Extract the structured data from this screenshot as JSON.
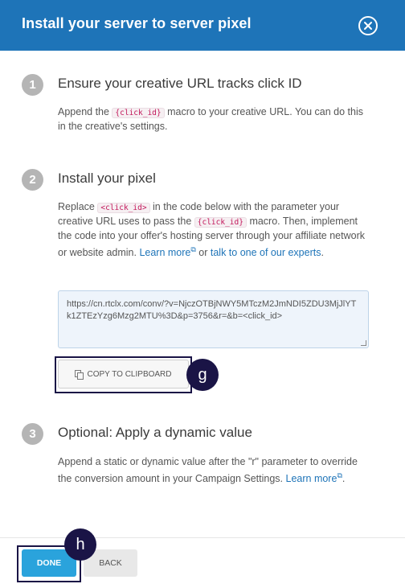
{
  "header": {
    "title": "Install your server to server pixel",
    "close_icon": "close-circle-icon"
  },
  "steps": [
    {
      "number": "1",
      "title": "Ensure your creative URL tracks click ID",
      "text_a": "Append the ",
      "macro": "{click_id}",
      "text_b": " macro to your creative URL. You can do this in the creative's settings."
    },
    {
      "number": "2",
      "title": "Install your pixel",
      "text_a": "Replace ",
      "macro_1": "<click_id>",
      "text_b": " in the code below with the parameter your creative URL uses to pass the ",
      "macro_2": "{click_id}",
      "text_c": " macro. Then, implement the code into your offer's hosting server through your affiliate network or website admin. ",
      "learn_more": "Learn more",
      "or_text": " or ",
      "experts_link": "talk to one of our experts",
      "end": ".",
      "code": "https://cn.rtclx.com/conv/?v=NjczOTBjNWY5MTczM2JmNDI5ZDU3MjJlYTk1ZTEzYzg6Mzg2MTU%3D&p=3756&r=&b=<click_id>",
      "copy_label": "COPY TO CLIPBOARD"
    },
    {
      "number": "3",
      "title": "Optional: Apply a dynamic value",
      "text_a": "Append a static or dynamic value after the \"r\" parameter to override the conversion amount in your Campaign Settings. ",
      "learn_more": "Learn more",
      "end": "."
    }
  ],
  "markers": {
    "copy": "g",
    "done": "h"
  },
  "footer": {
    "done_label": "DONE",
    "back_label": "BACK"
  },
  "colors": {
    "header_bg": "#1e74b8",
    "done_bg": "#2aa3dc",
    "marker_bg": "#1a1446",
    "link": "#1e74b8"
  }
}
